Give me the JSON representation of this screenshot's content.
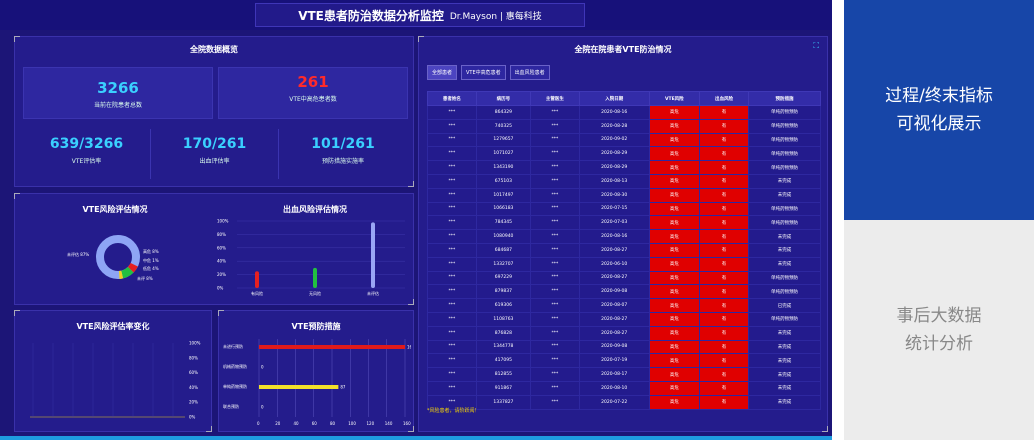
{
  "header": {
    "title": "VTE患者防治数据分析监控",
    "brand": "Dr.Mayson | 惠每科技"
  },
  "overview": {
    "title": "全院数据概览",
    "total_patients": {
      "value": "3266",
      "label": "当前在院患者总数"
    },
    "high_risk": {
      "value": "261",
      "label": "VTE中高危患者数"
    },
    "kpis": [
      {
        "value": "639/3266",
        "label": "VTE评估率"
      },
      {
        "value": "170/261",
        "label": "出血评估率"
      },
      {
        "value": "101/261",
        "label": "预防措施实施率"
      }
    ]
  },
  "vte_risk": {
    "title": "VTE风险评估情况",
    "legend": [
      "高危 8%",
      "中危 1%",
      "低危 4%",
      "未评 8%"
    ],
    "left_label": "未评估 87%"
  },
  "bleed_risk": {
    "title": "出血风险评估情况",
    "yticks": [
      "100%",
      "80%",
      "60%",
      "40%",
      "20%",
      "0%"
    ],
    "categories": [
      "有风险",
      "无风险",
      "未评估"
    ],
    "values": [
      0.25,
      0.3,
      0.98
    ]
  },
  "trend": {
    "title": "VTE风险评估率变化",
    "yticks": [
      "100%",
      "80%",
      "60%",
      "40%",
      "20%",
      "0%"
    ]
  },
  "prevention": {
    "title": "VTE预防措施",
    "rows": [
      {
        "label": "未进行预防",
        "value": 160
      },
      {
        "label": "机械药物预防",
        "value": 0
      },
      {
        "label": "单纯药物预防",
        "value": 87
      },
      {
        "label": "联合预防",
        "value": 0
      }
    ],
    "xticks": [
      "0",
      "20",
      "40",
      "60",
      "80",
      "100",
      "120",
      "140",
      "160"
    ]
  },
  "inpatient": {
    "title": "全院在院患者VTE防治情况",
    "tabs": [
      "全部患者",
      "VTE中高危患者",
      "出血风险患者"
    ],
    "columns": [
      "患者姓名",
      "病历号",
      "主管医生",
      "入院日期",
      "VTE风险",
      "出血风险",
      "预防措施"
    ],
    "rows": [
      [
        "***",
        "864329",
        "***",
        "2020-08-16",
        "高危",
        "有",
        "单纯药物预防"
      ],
      [
        "***",
        "740325",
        "***",
        "2020-08-28",
        "高危",
        "有",
        "单纯药物预防"
      ],
      [
        "***",
        "1279657",
        "***",
        "2020-09-02",
        "高危",
        "有",
        "单纯药物预防"
      ],
      [
        "***",
        "1071027",
        "***",
        "2020-08-29",
        "高危",
        "有",
        "单纯药物预防"
      ],
      [
        "***",
        "1343190",
        "***",
        "2020-08-29",
        "高危",
        "有",
        "单纯药物预防"
      ],
      [
        "***",
        "675103",
        "***",
        "2020-08-13",
        "高危",
        "有",
        "未完成"
      ],
      [
        "***",
        "1017497",
        "***",
        "2020-08-30",
        "高危",
        "有",
        "未完成"
      ],
      [
        "***",
        "1066183",
        "***",
        "2020-07-15",
        "高危",
        "有",
        "单纯药物预防"
      ],
      [
        "***",
        "784345",
        "***",
        "2020-07-03",
        "高危",
        "有",
        "单纯药物预防"
      ],
      [
        "***",
        "1080940",
        "***",
        "2020-08-16",
        "高危",
        "有",
        "未完成"
      ],
      [
        "***",
        "684687",
        "***",
        "2020-08-27",
        "高危",
        "有",
        "未完成"
      ],
      [
        "***",
        "1332707",
        "***",
        "2020-06-10",
        "高危",
        "有",
        "未完成"
      ],
      [
        "***",
        "697229",
        "***",
        "2020-08-27",
        "高危",
        "有",
        "单纯药物预防"
      ],
      [
        "***",
        "879837",
        "***",
        "2020-09-08",
        "高危",
        "有",
        "单纯药物预防"
      ],
      [
        "***",
        "619306",
        "***",
        "2020-08-07",
        "高危",
        "有",
        "已完成"
      ],
      [
        "***",
        "1108763",
        "***",
        "2020-08-27",
        "高危",
        "有",
        "单纯药物预防"
      ],
      [
        "***",
        "876828",
        "***",
        "2020-08-27",
        "高危",
        "有",
        "未完成"
      ],
      [
        "***",
        "1344778",
        "***",
        "2020-09-08",
        "高危",
        "有",
        "未完成"
      ],
      [
        "***",
        "417095",
        "***",
        "2020-07-19",
        "高危",
        "有",
        "未完成"
      ],
      [
        "***",
        "812855",
        "***",
        "2020-08-17",
        "高危",
        "有",
        "未完成"
      ],
      [
        "***",
        "911867",
        "***",
        "2020-08-10",
        "高危",
        "有",
        "未完成"
      ],
      [
        "***",
        "1337827",
        "***",
        "2020-07-22",
        "高危",
        "有",
        "未完成"
      ]
    ],
    "footnote": "*风险患者，请阶跃阅！"
  },
  "side": {
    "top": [
      "过程/终末指标",
      "可视化展示"
    ],
    "bottom": [
      "事后大数据",
      "统计分析"
    ]
  },
  "colors": {
    "bg": "#1c1577",
    "accent": "#3ad0ff",
    "risk": "#e00000",
    "side_blue": "#1746a8"
  }
}
